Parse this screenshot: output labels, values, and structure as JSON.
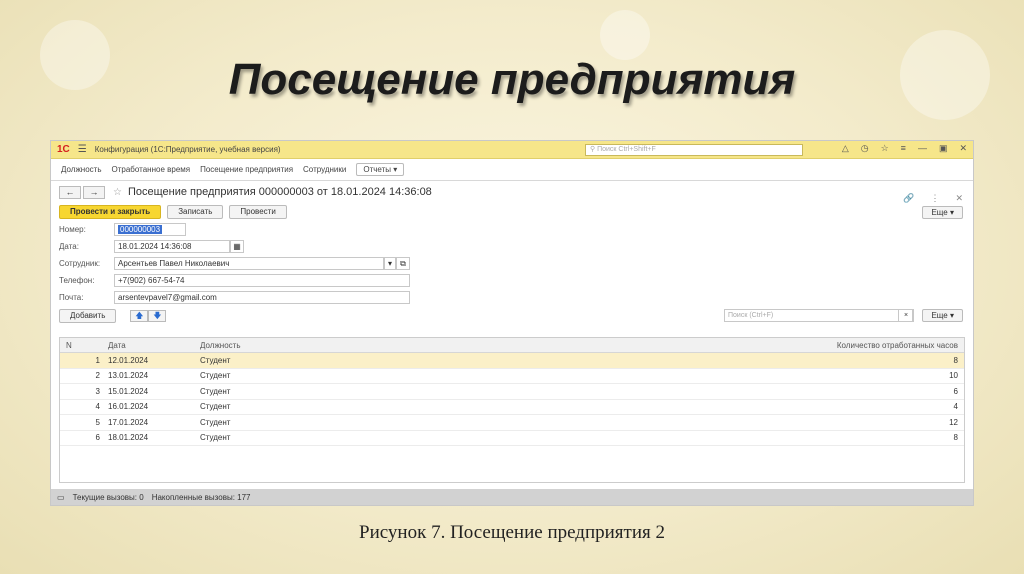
{
  "slide": {
    "title": "Посещение предприятия",
    "caption": "Рисунок 7. Посещение предприятия 2"
  },
  "app": {
    "logo": "1С",
    "title": "Конфигурация  (1С:Предприятие, учебная версия)",
    "search_placeholder": "Поиск Ctrl+Shift+F"
  },
  "sections": [
    "Должность",
    "Отработанное время",
    "Посещение предприятия",
    "Сотрудники"
  ],
  "reports_label": "Отчеты",
  "document": {
    "title": "Посещение предприятия 000000003 от 18.01.2024 14:36:08",
    "post_close_label": "Провести и закрыть",
    "save_label": "Записать",
    "post_label": "Провести",
    "more_label": "Еще"
  },
  "fields": {
    "number_label": "Номер:",
    "number_value": "000000003",
    "date_label": "Дата:",
    "date_value": "18.01.2024 14:36:08",
    "employee_label": "Сотрудник:",
    "employee_value": "Арсентьев Павел Николаевич",
    "phone_label": "Телефон:",
    "phone_value": "+7(902) 667-54-74",
    "email_label": "Почта:",
    "email_value": "arsentevpavel7@gmail.com"
  },
  "table_toolbar": {
    "add_label": "Добавить",
    "search_placeholder": "Поиск (Ctrl+F)",
    "more_label": "Еще"
  },
  "table": {
    "headers": {
      "n": "N",
      "date": "Дата",
      "position": "Должность",
      "hours": "Количество отработанных часов"
    },
    "rows": [
      {
        "n": "1",
        "date": "12.01.2024",
        "position": "Студент",
        "hours": "8"
      },
      {
        "n": "2",
        "date": "13.01.2024",
        "position": "Студент",
        "hours": "10"
      },
      {
        "n": "3",
        "date": "15.01.2024",
        "position": "Студент",
        "hours": "6"
      },
      {
        "n": "4",
        "date": "16.01.2024",
        "position": "Студент",
        "hours": "4"
      },
      {
        "n": "5",
        "date": "17.01.2024",
        "position": "Студент",
        "hours": "12"
      },
      {
        "n": "6",
        "date": "18.01.2024",
        "position": "Студент",
        "hours": "8"
      }
    ]
  },
  "status": {
    "current_calls": "Текущие вызовы: 0",
    "accumulated_calls": "Накопленные вызовы: 177"
  }
}
